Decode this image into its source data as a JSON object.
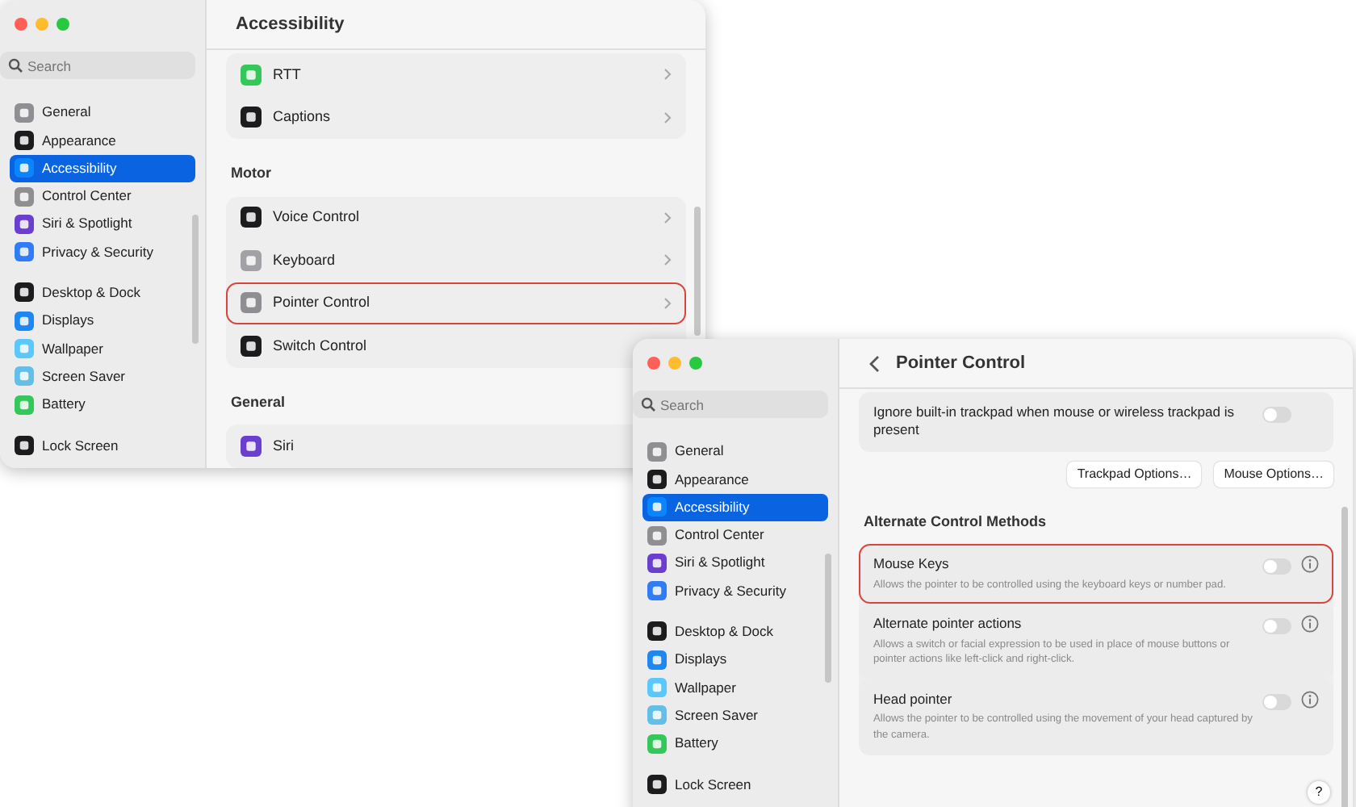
{
  "windows": [
    {
      "title": "Accessibility",
      "back": false,
      "search": {
        "placeholder": "Search"
      },
      "sidebar": {
        "groups": [
          [
            {
              "label": "General",
              "color": "#8e8e93",
              "selected": false
            },
            {
              "label": "Appearance",
              "color": "#1c1c1e",
              "selected": false
            },
            {
              "label": "Accessibility",
              "color": "#0a84ff",
              "selected": true
            },
            {
              "label": "Control Center",
              "color": "#8e8e93",
              "selected": false
            },
            {
              "label": "Siri & Spotlight",
              "color": "#6a3fd0",
              "selected": false
            },
            {
              "label": "Privacy & Security",
              "color": "#2f7cf6",
              "selected": false
            }
          ],
          [
            {
              "label": "Desktop & Dock",
              "color": "#1c1c1e",
              "selected": false
            },
            {
              "label": "Displays",
              "color": "#1e88f0",
              "selected": false
            },
            {
              "label": "Wallpaper",
              "color": "#5ac8fa",
              "selected": false
            },
            {
              "label": "Screen Saver",
              "color": "#64bfe6",
              "selected": false
            },
            {
              "label": "Battery",
              "color": "#34c759",
              "selected": false
            }
          ],
          [
            {
              "label": "Lock Screen",
              "color": "#1c1c1e",
              "selected": false
            }
          ]
        ]
      },
      "sections": [
        {
          "items": [
            {
              "kind": "link",
              "label": "RTT",
              "color": "#34c759",
              "highlighted": false
            },
            {
              "kind": "link",
              "label": "Captions",
              "color": "#1c1c1e",
              "highlighted": false
            }
          ]
        },
        {
          "heading": "Motor",
          "items": [
            {
              "kind": "link",
              "label": "Voice Control",
              "color": "#1c1c1e",
              "highlighted": false
            },
            {
              "kind": "link",
              "label": "Keyboard",
              "color": "#a1a1a6",
              "highlighted": false
            },
            {
              "kind": "link",
              "label": "Pointer Control",
              "color": "#8e8e93",
              "highlighted": true
            },
            {
              "kind": "link",
              "label": "Switch Control",
              "color": "#1c1c1e",
              "highlighted": false
            }
          ]
        },
        {
          "heading": "General",
          "items": [
            {
              "kind": "link",
              "label": "Siri",
              "color": "#6a3fd0",
              "highlighted": false
            }
          ]
        }
      ]
    },
    {
      "title": "Pointer Control",
      "back": true,
      "search": {
        "placeholder": "Search"
      },
      "sidebar": {
        "groups": [
          [
            {
              "label": "General",
              "color": "#8e8e93",
              "selected": false
            },
            {
              "label": "Appearance",
              "color": "#1c1c1e",
              "selected": false
            },
            {
              "label": "Accessibility",
              "color": "#0a84ff",
              "selected": true
            },
            {
              "label": "Control Center",
              "color": "#8e8e93",
              "selected": false
            },
            {
              "label": "Siri & Spotlight",
              "color": "#6a3fd0",
              "selected": false
            },
            {
              "label": "Privacy & Security",
              "color": "#2f7cf6",
              "selected": false
            }
          ],
          [
            {
              "label": "Desktop & Dock",
              "color": "#1c1c1e",
              "selected": false
            },
            {
              "label": "Displays",
              "color": "#1e88f0",
              "selected": false
            },
            {
              "label": "Wallpaper",
              "color": "#5ac8fa",
              "selected": false
            },
            {
              "label": "Screen Saver",
              "color": "#64bfe6",
              "selected": false
            },
            {
              "label": "Battery",
              "color": "#34c759",
              "selected": false
            }
          ],
          [
            {
              "label": "Lock Screen",
              "color": "#1c1c1e",
              "selected": false
            }
          ]
        ]
      },
      "sections": [
        {
          "items": [
            {
              "kind": "toggle",
              "label": "Ignore built-in trackpad when mouse or wireless trackpad is present",
              "on": false,
              "info": false,
              "highlighted": false
            },
            {
              "kind": "buttons",
              "buttons": [
                "Trackpad Options…",
                "Mouse Options…"
              ]
            }
          ]
        },
        {
          "heading": "Alternate Control Methods",
          "items": [
            {
              "kind": "toggle",
              "label": "Mouse Keys",
              "description": "Allows the pointer to be controlled using the keyboard keys or number pad.",
              "on": false,
              "info": true,
              "highlighted": true
            },
            {
              "kind": "toggle",
              "label": "Alternate pointer actions",
              "description": "Allows a switch or facial expression to be used in place of mouse buttons or pointer actions like left-click and right-click.",
              "on": false,
              "info": true,
              "highlighted": false
            },
            {
              "kind": "toggle",
              "label": "Head pointer",
              "description": "Allows the pointer to be controlled using the movement of your head captured by the camera.",
              "on": false,
              "info": true,
              "highlighted": false
            }
          ]
        }
      ],
      "help": "?"
    }
  ]
}
